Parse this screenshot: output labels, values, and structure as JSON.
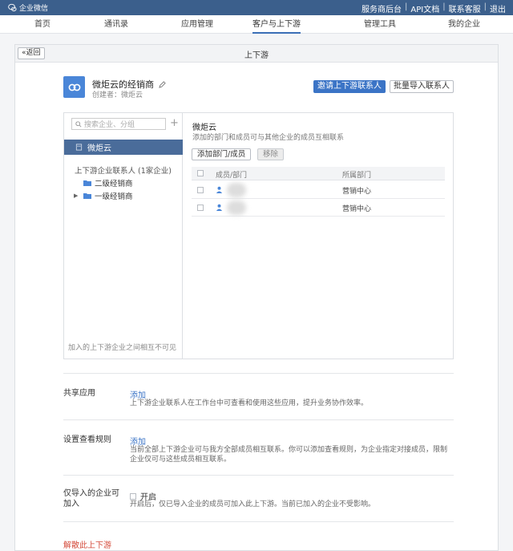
{
  "topbar": {
    "brand": "企业微信",
    "links": [
      "服务商后台",
      "API文档",
      "联系客服",
      "退出"
    ]
  },
  "nav": {
    "items": [
      "首页",
      "通讯录",
      "应用管理",
      "客户与上下游",
      "管理工具",
      "我的企业"
    ],
    "active": "客户与上下游"
  },
  "page": {
    "back_label": "«返回",
    "title": "上下游"
  },
  "corp": {
    "name": "微炬云的经销商",
    "creator": "创建者：微炬云",
    "invite_button": "邀请上下游联系人",
    "import_button": "批量导入联系人"
  },
  "left_panel": {
    "search_placeholder": "搜索企业、分组",
    "selected_org": "微炬云",
    "group_label": "上下游企业联系人 (1家企业)",
    "tree": [
      {
        "label": "二级经销商",
        "expandable": false
      },
      {
        "label": "一级经销商",
        "expandable": true
      }
    ],
    "footer": "加入的上下游企业之间相互不可见"
  },
  "right_panel": {
    "title": "微炬云",
    "desc": "添加的部门和成员可与其他企业的成员互相联系",
    "add_button": "添加部门/成员",
    "remove_button": "移除",
    "columns": [
      "成员/部门",
      "所属部门"
    ],
    "rows": [
      {
        "dept": "营销中心"
      },
      {
        "dept": "营销中心"
      }
    ]
  },
  "settings": {
    "shared_apps": {
      "label": "共享应用",
      "link": "添加",
      "desc": "上下游企业联系人在工作台中可查看和使用这些应用，提升业务协作效率。"
    },
    "view_rules": {
      "label": "设置查看规则",
      "link": "添加",
      "desc": "当前全部上下游企业可与我方全部成员相互联系。你可以添加查看规则，为企业指定对接成员，限制企业仅可与这些成员相互联系。"
    },
    "import_only": {
      "label": "仅导入的企业可加入",
      "toggle_label": "开启",
      "desc": "开启后，仅已导入企业的成员可加入此上下游。当前已加入的企业不受影响。"
    },
    "dissolve": "解散此上下游"
  },
  "colors": {
    "topbar": "#3b5f8c",
    "primary": "#3b74c6",
    "selected": "#4a6c9a",
    "danger": "#d44a3a"
  }
}
